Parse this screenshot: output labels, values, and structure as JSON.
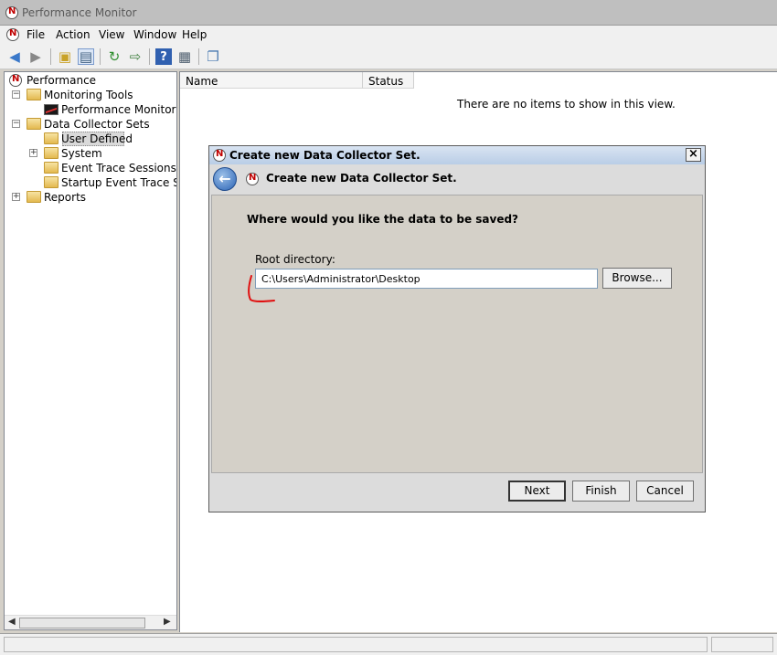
{
  "app": {
    "title": "Performance Monitor",
    "menu": [
      "File",
      "Action",
      "View",
      "Window",
      "Help"
    ]
  },
  "toolbar": {
    "icons": [
      "back-arrow-icon",
      "forward-arrow-icon",
      "up-folder-icon",
      "show-hide-tree-icon",
      "refresh-icon",
      "export-icon",
      "help-icon",
      "properties-icon",
      "new-window-icon"
    ]
  },
  "tree": {
    "root": "Performance",
    "items": [
      {
        "label": "Monitoring Tools"
      },
      {
        "label": "Performance Monitor"
      },
      {
        "label": "Data Collector Sets"
      },
      {
        "label": "User Defined"
      },
      {
        "label": "System"
      },
      {
        "label": "Event Trace Sessions"
      },
      {
        "label": "Startup Event Trace Sess"
      },
      {
        "label": "Reports"
      }
    ]
  },
  "list": {
    "columns": [
      "Name",
      "Status"
    ],
    "empty_message": "There are no items to show in this view."
  },
  "dialog": {
    "title": "Create new Data Collector Set.",
    "header": "Create new Data Collector Set.",
    "question": "Where would you like the data to be saved?",
    "root_label": "Root directory:",
    "root_value": "C:\\Users\\Administrator\\Desktop",
    "browse": "Browse...",
    "next": "Next",
    "finish": "Finish",
    "cancel": "Cancel"
  },
  "colors": {
    "annotation": "#e01010",
    "selection": "#d9d9d9"
  }
}
